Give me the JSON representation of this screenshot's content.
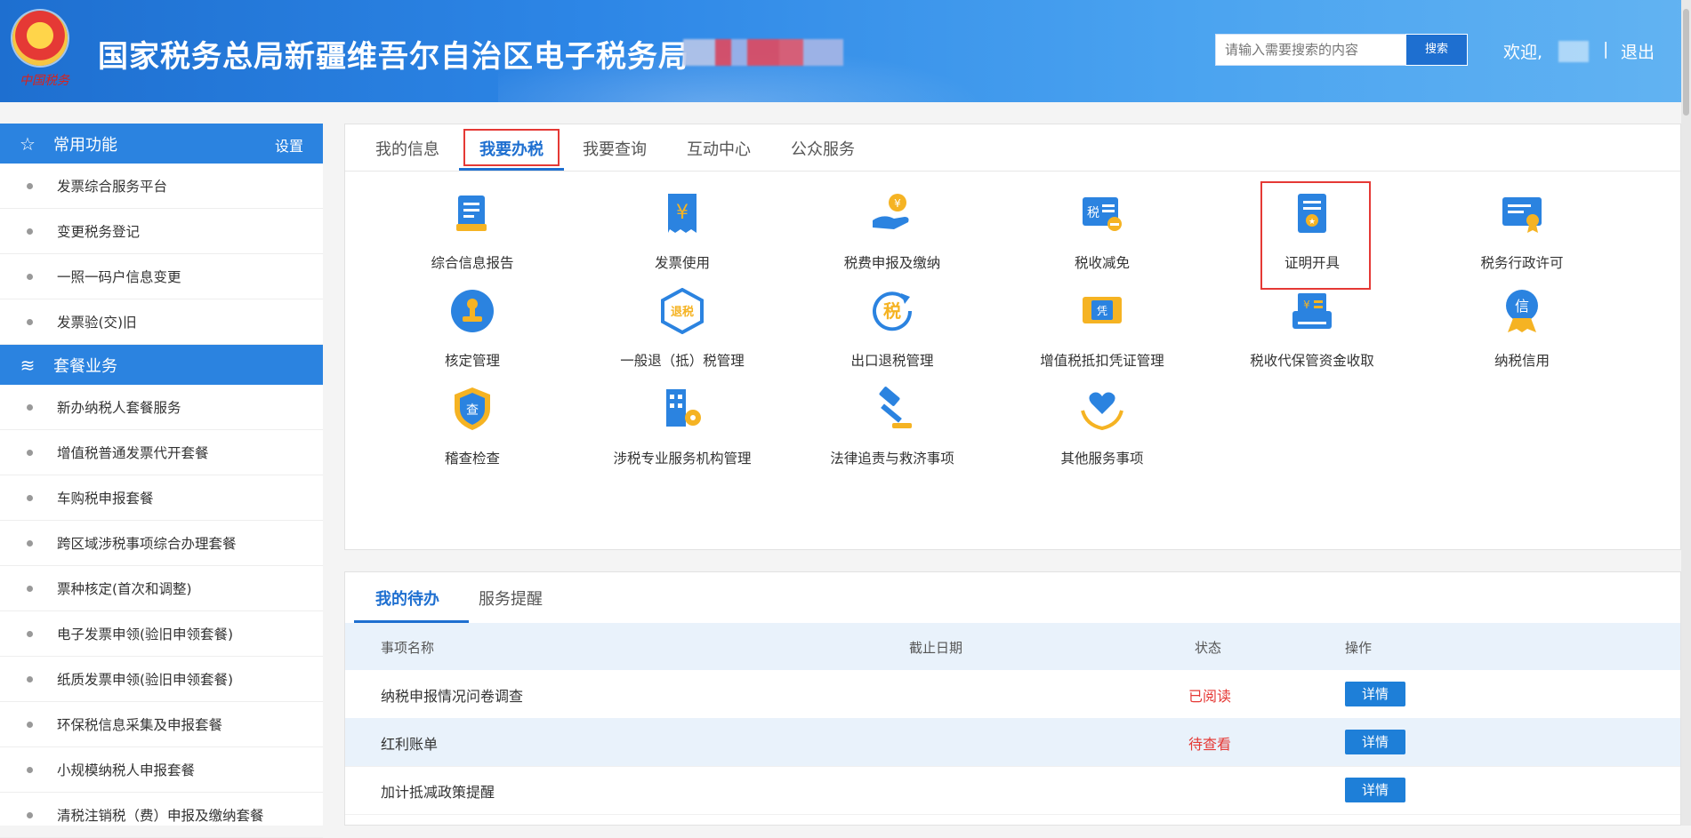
{
  "header": {
    "title": "国家税务总局新疆维吾尔自治区电子税务局",
    "emblem_text": "中国税务",
    "search_placeholder": "请输入需要搜索的内容",
    "search_button": "搜索",
    "welcome": "欢迎,",
    "separator": "|",
    "logout": "退出"
  },
  "sidebar": {
    "group1": {
      "title": "常用功能",
      "setting": "设置",
      "items": [
        "发票综合服务平台",
        "变更税务登记",
        "一照一码户信息变更",
        "发票验(交)旧"
      ]
    },
    "group2": {
      "title": "套餐业务",
      "items": [
        "新办纳税人套餐服务",
        "增值税普通发票代开套餐",
        "车购税申报套餐",
        "跨区域涉税事项综合办理套餐",
        "票种核定(首次和调整)",
        "电子发票申领(验旧申领套餐)",
        "纸质发票申领(验旧申领套餐)",
        "环保税信息采集及申报套餐",
        "小规模纳税人申报套餐",
        "清税注销税（费）申报及缴纳套餐"
      ]
    }
  },
  "main_tabs": [
    "我的信息",
    "我要办税",
    "我要查询",
    "互动中心",
    "公众服务"
  ],
  "services": [
    {
      "label": "综合信息报告",
      "icon": "report-icon"
    },
    {
      "label": "发票使用",
      "icon": "invoice-icon"
    },
    {
      "label": "税费申报及缴纳",
      "icon": "payment-icon"
    },
    {
      "label": "税收减免",
      "icon": "tax-reduction-icon"
    },
    {
      "label": "证明开具",
      "icon": "certificate-icon"
    },
    {
      "label": "税务行政许可",
      "icon": "license-icon"
    },
    {
      "label": "核定管理",
      "icon": "stamp-icon"
    },
    {
      "label": "一般退（抵）税管理",
      "icon": "refund-icon"
    },
    {
      "label": "出口退税管理",
      "icon": "export-refund-icon"
    },
    {
      "label": "增值税抵扣凭证管理",
      "icon": "voucher-icon"
    },
    {
      "label": "税收代保管资金收取",
      "icon": "fund-icon"
    },
    {
      "label": "纳税信用",
      "icon": "credit-icon"
    },
    {
      "label": "稽查检查",
      "icon": "inspection-icon"
    },
    {
      "label": "涉税专业服务机构管理",
      "icon": "agency-icon"
    },
    {
      "label": "法律追责与救济事项",
      "icon": "gavel-icon"
    },
    {
      "label": "其他服务事项",
      "icon": "heart-hand-icon"
    }
  ],
  "bottom_tabs": [
    "我的待办",
    "服务提醒"
  ],
  "todo_table": {
    "columns": [
      "事项名称",
      "截止日期",
      "状态",
      "操作"
    ],
    "rows": [
      {
        "name": "纳税申报情况问卷调查",
        "deadline": "",
        "status": "已阅读",
        "action": "详情"
      },
      {
        "name": "红利账单",
        "deadline": "",
        "status": "待查看",
        "action": "详情"
      },
      {
        "name": "加计抵减政策提醒",
        "deadline": "",
        "status": "",
        "action": "详情"
      }
    ]
  },
  "icons": {
    "home_star": "star-icon",
    "package": "layers-icon"
  },
  "colors": {
    "brand": "#1e6fd0",
    "highlight": "#e53935"
  }
}
